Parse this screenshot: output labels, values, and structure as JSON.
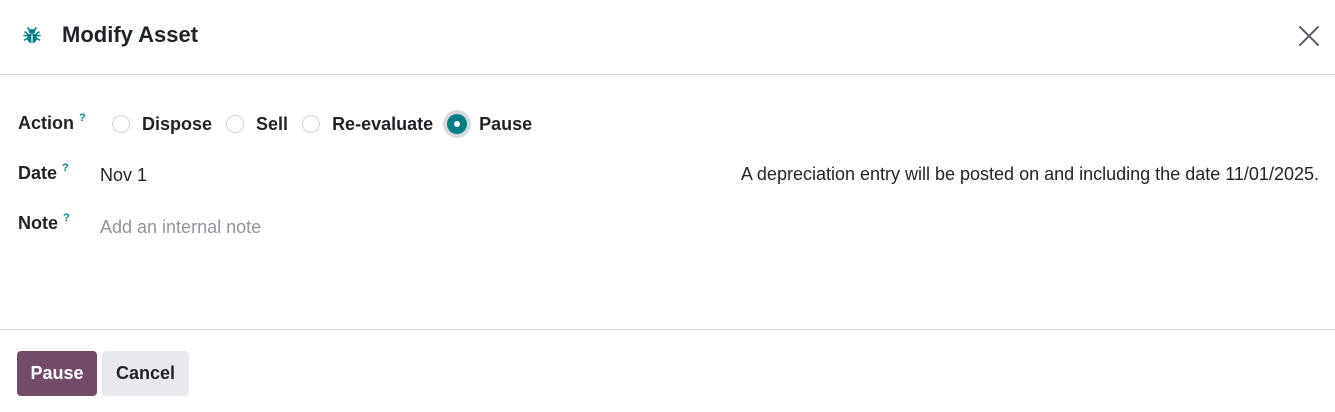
{
  "dialog": {
    "title": "Modify Asset",
    "icon": "bug-icon",
    "close_icon": "close-icon"
  },
  "form": {
    "action": {
      "label": "Action",
      "help": "?",
      "options": [
        {
          "label": "Dispose",
          "checked": false
        },
        {
          "label": "Sell",
          "checked": false
        },
        {
          "label": "Re-evaluate",
          "checked": false
        },
        {
          "label": "Pause",
          "checked": true
        }
      ]
    },
    "date": {
      "label": "Date",
      "help": "?",
      "value": "Nov 1",
      "info": "A depreciation entry will be posted on and including the date 11/01/2025."
    },
    "note": {
      "label": "Note",
      "help": "?",
      "placeholder": "Add an internal note",
      "value": ""
    }
  },
  "footer": {
    "primary_label": "Pause",
    "secondary_label": "Cancel"
  },
  "colors": {
    "accent": "#017e84",
    "primary_button": "#714b67",
    "secondary_button": "#e7e9ed",
    "help": "#0b7b87"
  }
}
